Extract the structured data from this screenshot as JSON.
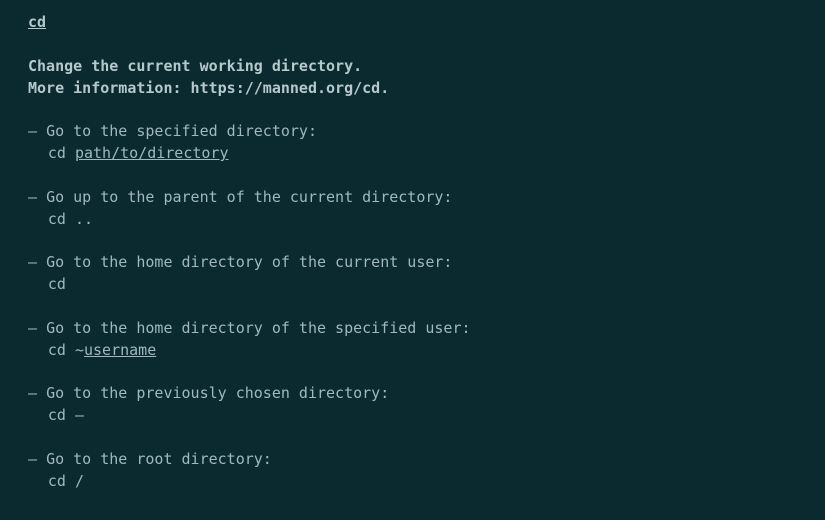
{
  "title": "cd",
  "description": "Change the current working directory.",
  "more_info": "More information: https://manned.org/cd.",
  "entries": [
    {
      "desc": "Go to the specified directory:",
      "cmd_prefix": "cd ",
      "arg": "path/to/directory",
      "cmd_suffix": ""
    },
    {
      "desc": "Go up to the parent of the current directory:",
      "cmd_prefix": "cd ..",
      "arg": "",
      "cmd_suffix": ""
    },
    {
      "desc": "Go to the home directory of the current user:",
      "cmd_prefix": "cd",
      "arg": "",
      "cmd_suffix": ""
    },
    {
      "desc": "Go to the home directory of the specified user:",
      "cmd_prefix": "cd ~",
      "arg": "username",
      "cmd_suffix": ""
    },
    {
      "desc": "Go to the previously chosen directory:",
      "cmd_prefix": "cd –",
      "arg": "",
      "cmd_suffix": ""
    },
    {
      "desc": "Go to the root directory:",
      "cmd_prefix": "cd /",
      "arg": "",
      "cmd_suffix": ""
    }
  ]
}
